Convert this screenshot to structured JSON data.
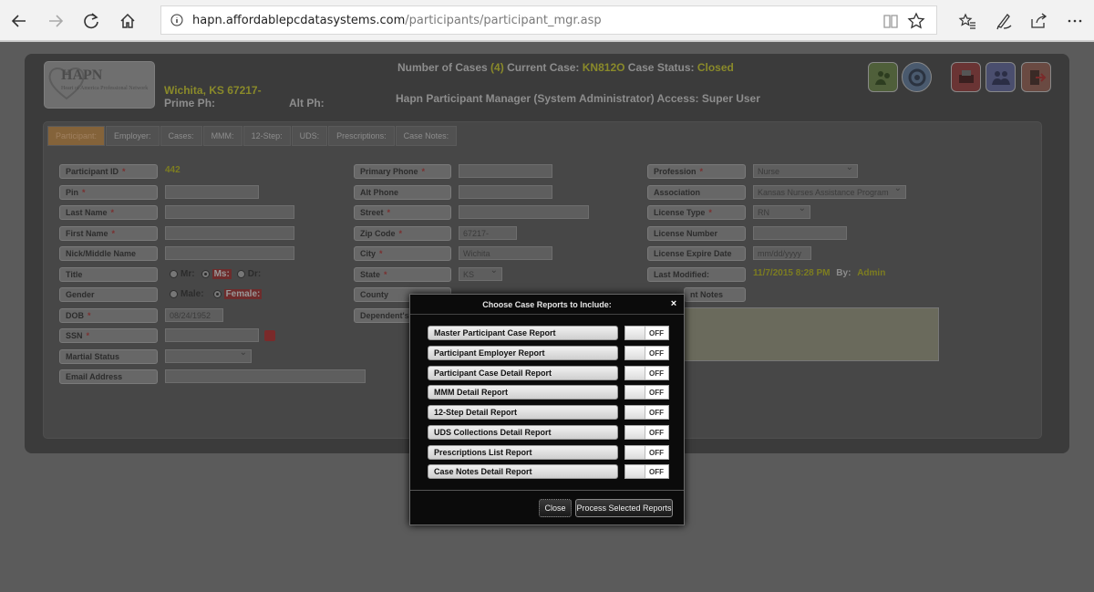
{
  "browser": {
    "url_host": "hapn.affordablepcdatasystems.com",
    "url_path": "/participants/participant_mgr.asp"
  },
  "header": {
    "logo_title": "HAPN",
    "logo_subtitle": "Heart of America Professional Network",
    "city_state": "Wichita, KS 67217-",
    "prime_ph_label": "Prime Ph:",
    "alt_ph_label": "Alt Ph:",
    "num_cases_label": "Number of Cases",
    "num_cases_value": "(4)",
    "current_case_label": "Current Case:",
    "current_case_value": "KN812O",
    "case_status_label": "Case Status:",
    "case_status_value": "Closed",
    "app_title": "Hapn Participant Manager (System Administrator) Access: Super User"
  },
  "tabs": [
    "Participant:",
    "Employer:",
    "Cases:",
    "MMM:",
    "12-Step:",
    "UDS:",
    "Prescriptions:",
    "Case Notes:"
  ],
  "form": {
    "col1": {
      "participant_id_label": "Participant ID",
      "participant_id_value": "442",
      "pin_label": "Pin",
      "last_name_label": "Last Name",
      "first_name_label": "First Name",
      "nick_label": "Nick/Middle Name",
      "title_label": "Title",
      "title_mr": "Mr:",
      "title_ms": "Ms:",
      "title_dr": "Dr:",
      "gender_label": "Gender",
      "gender_male": "Male:",
      "gender_female": "Female:",
      "dob_label": "DOB",
      "dob_value": "08/24/1952",
      "ssn_label": "SSN",
      "marital_label": "Martial Status",
      "email_label": "Email Address"
    },
    "col2": {
      "primary_phone_label": "Primary Phone",
      "alt_phone_label": "Alt Phone",
      "street_label": "Street",
      "zip_label": "Zip Code",
      "zip_value": "67217-",
      "city_label": "City",
      "city_value": "Wichita",
      "state_label": "State",
      "state_value": "KS",
      "county_label": "County",
      "dependents_label": "Dependent's"
    },
    "col3": {
      "profession_label": "Profession",
      "profession_value": "Nurse",
      "association_label": "Association",
      "association_value": "Kansas Nurses Assistance Program",
      "license_type_label": "License Type",
      "license_type_value": "RN",
      "license_number_label": "License Number",
      "license_expire_label": "License Expire Date",
      "license_expire_placeholder": "mm/dd/yyyy",
      "last_modified_label": "Last Modified:",
      "last_modified_value": "11/7/2015 8:28 PM",
      "by_label": "By:",
      "by_value": "Admin",
      "notes_label_partial": "nt Notes"
    }
  },
  "modal": {
    "title": "Choose Case Reports to Include:",
    "close_x": "×",
    "reports": [
      {
        "label": "Master Participant Case Report",
        "state": "OFF"
      },
      {
        "label": "Participant Employer Report",
        "state": "OFF"
      },
      {
        "label": "Participant Case Detail Report",
        "state": "OFF"
      },
      {
        "label": "MMM Detail Report",
        "state": "OFF"
      },
      {
        "label": "12-Step Detail Report",
        "state": "OFF"
      },
      {
        "label": "UDS Collections Detail Report",
        "state": "OFF"
      },
      {
        "label": "Prescriptions List Report",
        "state": "OFF"
      },
      {
        "label": "Case Notes Detail Report",
        "state": "OFF"
      }
    ],
    "close_button": "Close",
    "process_button": "Process Selected Reports"
  },
  "colors": {
    "overlay_bg": "#5b5b5b",
    "panel_bg": "#3b3b3b",
    "accent_yellow": "#8a8a2a",
    "active_tab": "#84633a",
    "modal_bg": "#0b0b0b"
  }
}
